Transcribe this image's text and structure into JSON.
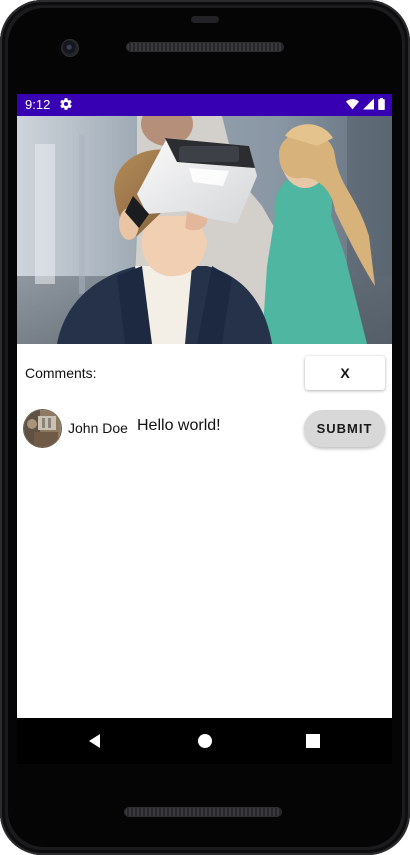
{
  "status_bar": {
    "time": "9:12",
    "background_color": "#3700b3",
    "icons": [
      "settings-gear-icon",
      "wifi-icon",
      "signal-icon",
      "battery-icon"
    ]
  },
  "hero": {
    "image": "child-wearing-vr-headset-photo"
  },
  "comments": {
    "label": "Comments:",
    "close_button_label": "X"
  },
  "comment": {
    "author": "John Doe",
    "text": "Hello world!",
    "avatar": "user-avatar-photo"
  },
  "submit_button_label": "SUBMIT",
  "navigation": {
    "icons": [
      "back-icon",
      "home-icon",
      "recents-icon"
    ]
  }
}
